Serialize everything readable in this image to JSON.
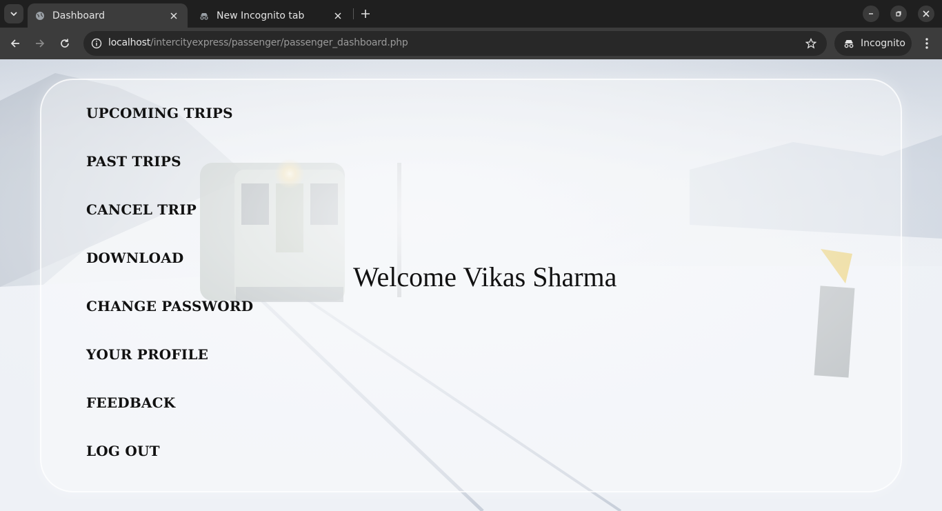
{
  "browser": {
    "tabs": [
      {
        "title": "Dashboard",
        "active": true,
        "icon": "globe-icon"
      },
      {
        "title": "New Incognito tab",
        "active": false,
        "icon": "incognito-icon"
      }
    ],
    "url_host": "localhost",
    "url_path": "/intercityexpress/passenger/passenger_dashboard.php",
    "incognito_label": "Incognito"
  },
  "sidebar": {
    "items": [
      {
        "label": "UPCOMING TRIPS"
      },
      {
        "label": "PAST TRIPS"
      },
      {
        "label": "CANCEL TRIP"
      },
      {
        "label": "DOWNLOAD"
      },
      {
        "label": "CHANGE PASSWORD"
      },
      {
        "label": "YOUR PROFILE"
      },
      {
        "label": "FEEDBACK"
      },
      {
        "label": "LOG OUT"
      }
    ]
  },
  "main": {
    "welcome": "Welcome Vikas Sharma"
  },
  "colors": {
    "chrome_dark": "#1f1f1f",
    "chrome_toolbar": "#3c3c3c",
    "text": "#111111"
  }
}
